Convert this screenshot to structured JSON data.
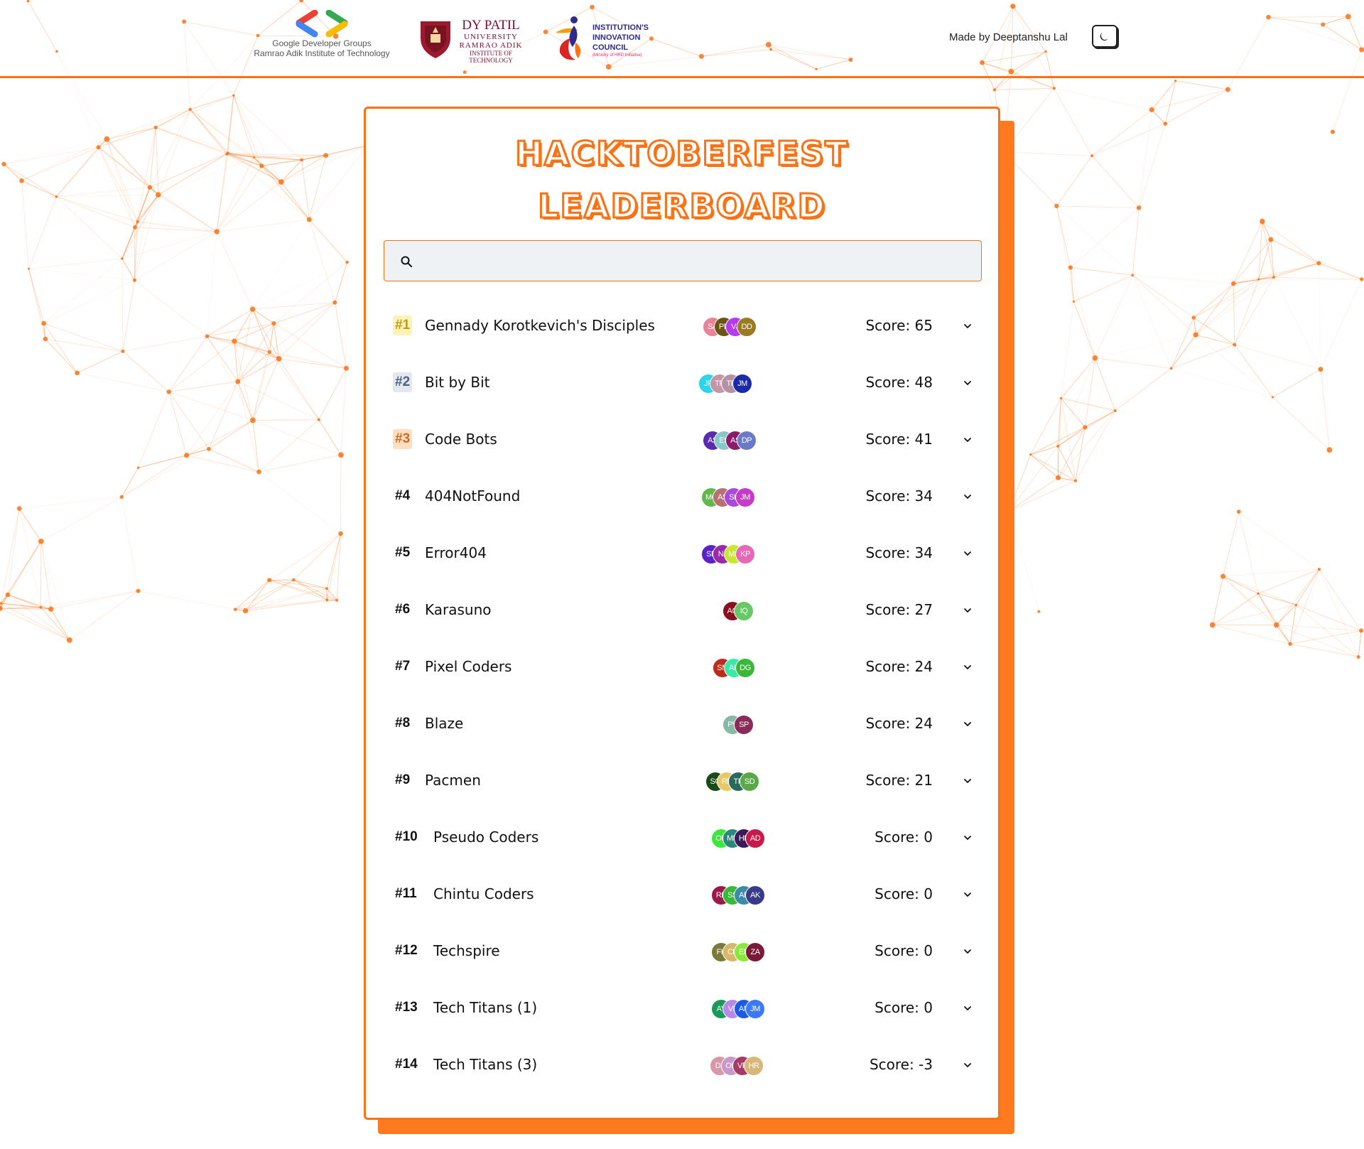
{
  "header": {
    "gdg_line1": "Google Developer Groups",
    "gdg_line2": "Ramrao Adik Institute of Technology",
    "dyp_line1": "DY PATIL",
    "dyp_line2": "UNIVERSITY",
    "dyp_line3": "RAMRAO ADIK",
    "dyp_line4": "INSTITUTE OF TECHNOLOGY",
    "iic_line1": "INSTITUTION'S",
    "iic_line2": "INNOVATION",
    "iic_line3": "COUNCIL",
    "iic_sub": "(Ministry of HRD Initiative)",
    "credit": "Made by Deeptanshu Lal",
    "theme_icon": "moon-icon"
  },
  "title": {
    "line1": "HACKTOBERFEST",
    "line2": "LEADERBOARD"
  },
  "search": {
    "placeholder": "",
    "value": ""
  },
  "colors": {
    "accent": "#f97316",
    "gold": "#fdf3b8",
    "silver": "#e4e8ee",
    "bronze": "#fde0c4"
  },
  "teams": [
    {
      "rank": "#1",
      "name": "Gennady Korotkevich's Disciples",
      "score": "Score: 65",
      "members": [
        {
          "i": "SA",
          "c": "#e8849a"
        },
        {
          "i": "PD",
          "c": "#6b5414"
        },
        {
          "i": "VJ",
          "c": "#b83af0"
        },
        {
          "i": "DD",
          "c": "#9c7a22"
        }
      ]
    },
    {
      "rank": "#2",
      "name": "Bit by Bit",
      "score": "Score: 48",
      "members": [
        {
          "i": "JP",
          "c": "#2ed4e8"
        },
        {
          "i": "TR",
          "c": "#c497a8"
        },
        {
          "i": "TP",
          "c": "#b591a6"
        },
        {
          "i": "JM",
          "c": "#1a2aa8"
        }
      ]
    },
    {
      "rank": "#3",
      "name": "Code Bots",
      "score": "Score: 41",
      "members": [
        {
          "i": "AS",
          "c": "#5a2bb0"
        },
        {
          "i": "ES",
          "c": "#88c8c8"
        },
        {
          "i": "AS",
          "c": "#8a1c6a"
        },
        {
          "i": "DP",
          "c": "#6a7ac8"
        }
      ]
    },
    {
      "rank": "#4",
      "name": "404NotFound",
      "score": "Score: 34",
      "members": [
        {
          "i": "MC",
          "c": "#62b84a"
        },
        {
          "i": "AS",
          "c": "#b87070"
        },
        {
          "i": "SK",
          "c": "#a84ad8"
        },
        {
          "i": "JM",
          "c": "#c83ac8"
        }
      ]
    },
    {
      "rank": "#5",
      "name": "Error404",
      "score": "Score: 34",
      "members": [
        {
          "i": "SP",
          "c": "#5a22c8"
        },
        {
          "i": "NJ",
          "c": "#9a2aa8"
        },
        {
          "i": "MS",
          "c": "#c8e830"
        },
        {
          "i": "KP",
          "c": "#e868b8"
        }
      ]
    },
    {
      "rank": "#6",
      "name": "Karasuno",
      "score": "Score: 27",
      "members": [
        {
          "i": "AG",
          "c": "#8a1020"
        },
        {
          "i": "IQ",
          "c": "#68c868"
        }
      ]
    },
    {
      "rank": "#7",
      "name": "Pixel Coders",
      "score": "Score: 24",
      "members": [
        {
          "i": "SM",
          "c": "#c02a1a"
        },
        {
          "i": "AN",
          "c": "#3ae8a8"
        },
        {
          "i": "DG",
          "c": "#3ab83a"
        }
      ]
    },
    {
      "rank": "#8",
      "name": "Blaze",
      "score": "Score: 24",
      "members": [
        {
          "i": "PV",
          "c": "#8ab8a8"
        },
        {
          "i": "SP",
          "c": "#8a2a5a"
        }
      ]
    },
    {
      "rank": "#9",
      "name": "Pacmen",
      "score": "Score: 21",
      "members": [
        {
          "i": "SG",
          "c": "#1a4a1a"
        },
        {
          "i": "RP",
          "c": "#e8c868"
        },
        {
          "i": "TP",
          "c": "#2a6a5a"
        },
        {
          "i": "SD",
          "c": "#5aa84a"
        }
      ]
    },
    {
      "rank": "#10",
      "name": "Pseudo Coders",
      "score": "Score: 0",
      "members": [
        {
          "i": "OD",
          "c": "#3ae83a"
        },
        {
          "i": "MD",
          "c": "#2a8a7a"
        },
        {
          "i": "HP",
          "c": "#3a1a5a"
        },
        {
          "i": "AD",
          "c": "#c81a4a"
        }
      ]
    },
    {
      "rank": "#11",
      "name": "Chintu Coders",
      "score": "Score: 0",
      "members": [
        {
          "i": "RP",
          "c": "#9a1a4a"
        },
        {
          "i": "SS",
          "c": "#3ab83a"
        },
        {
          "i": "AP",
          "c": "#3a8aa8"
        },
        {
          "i": "AK",
          "c": "#3a3a8a"
        }
      ]
    },
    {
      "rank": "#12",
      "name": "Techspire",
      "score": "Score: 0",
      "members": [
        {
          "i": "FK",
          "c": "#7a7a3a"
        },
        {
          "i": "CK",
          "c": "#d8b868"
        },
        {
          "i": "EN",
          "c": "#8ae83a"
        },
        {
          "i": "ZA",
          "c": "#7a1a3a"
        }
      ]
    },
    {
      "rank": "#13",
      "name": "Tech Titans (1)",
      "score": "Score: 0",
      "members": [
        {
          "i": "AY",
          "c": "#1a9a5a"
        },
        {
          "i": "VL",
          "c": "#b88ae8"
        },
        {
          "i": "AN",
          "c": "#1a5ae8"
        },
        {
          "i": "JM",
          "c": "#3a7af8"
        }
      ]
    },
    {
      "rank": "#14",
      "name": "Tech Titans (3)",
      "score": "Score: -3",
      "members": [
        {
          "i": "DJ",
          "c": "#d898a8"
        },
        {
          "i": "OD",
          "c": "#c898c8"
        },
        {
          "i": "VR",
          "c": "#a83a6a"
        },
        {
          "i": "HR",
          "c": "#d8b878"
        }
      ]
    }
  ]
}
